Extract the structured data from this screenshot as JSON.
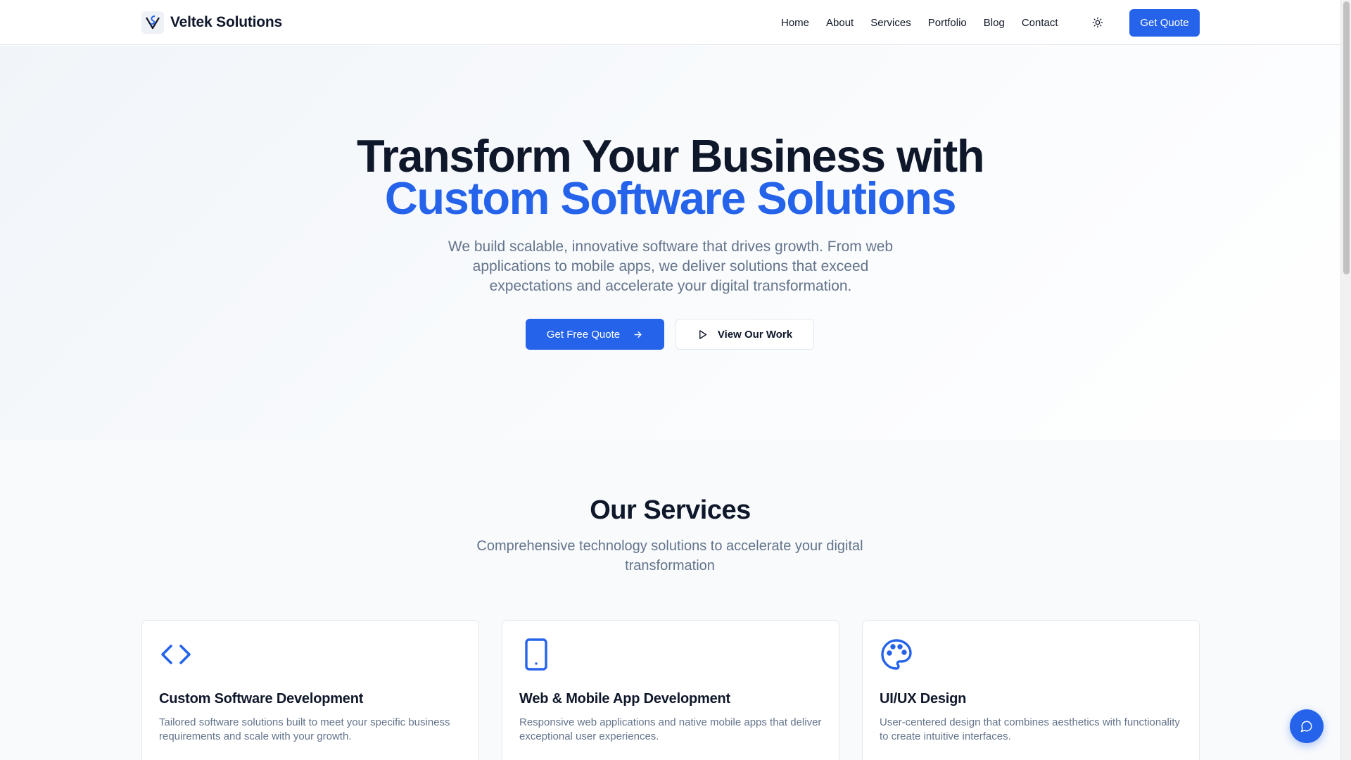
{
  "header": {
    "brand_name": "Veltek Solutions",
    "nav": [
      "Home",
      "About",
      "Services",
      "Portfolio",
      "Blog",
      "Contact"
    ],
    "theme_icon": "sun-icon",
    "cta_label": "Get Quote"
  },
  "hero": {
    "title_line1": "Transform Your Business with",
    "title_line2": "Custom Software Solutions",
    "subtitle": "We build scalable, innovative software that drives growth. From web applications to mobile apps, we deliver solutions that exceed expectations and accelerate your digital transformation.",
    "primary_label": "Get Free Quote",
    "secondary_label": "View Our Work"
  },
  "services": {
    "title": "Our Services",
    "subtitle": "Comprehensive technology solutions to accelerate your digital transformation",
    "cards": [
      {
        "icon": "code-icon",
        "title": "Custom Software Development",
        "desc": "Tailored software solutions built to meet your specific business requirements and scale with your growth."
      },
      {
        "icon": "smartphone-icon",
        "title": "Web & Mobile App Development",
        "desc": "Responsive web applications and native mobile apps that deliver exceptional user experiences."
      },
      {
        "icon": "palette-icon",
        "title": "UI/UX Design",
        "desc": "User-centered design that combines aesthetics with functionality to create intuitive interfaces."
      }
    ]
  },
  "colors": {
    "accent": "#2563eb",
    "text": "#0f172a",
    "muted": "#64748b",
    "border": "#e5e7eb"
  }
}
